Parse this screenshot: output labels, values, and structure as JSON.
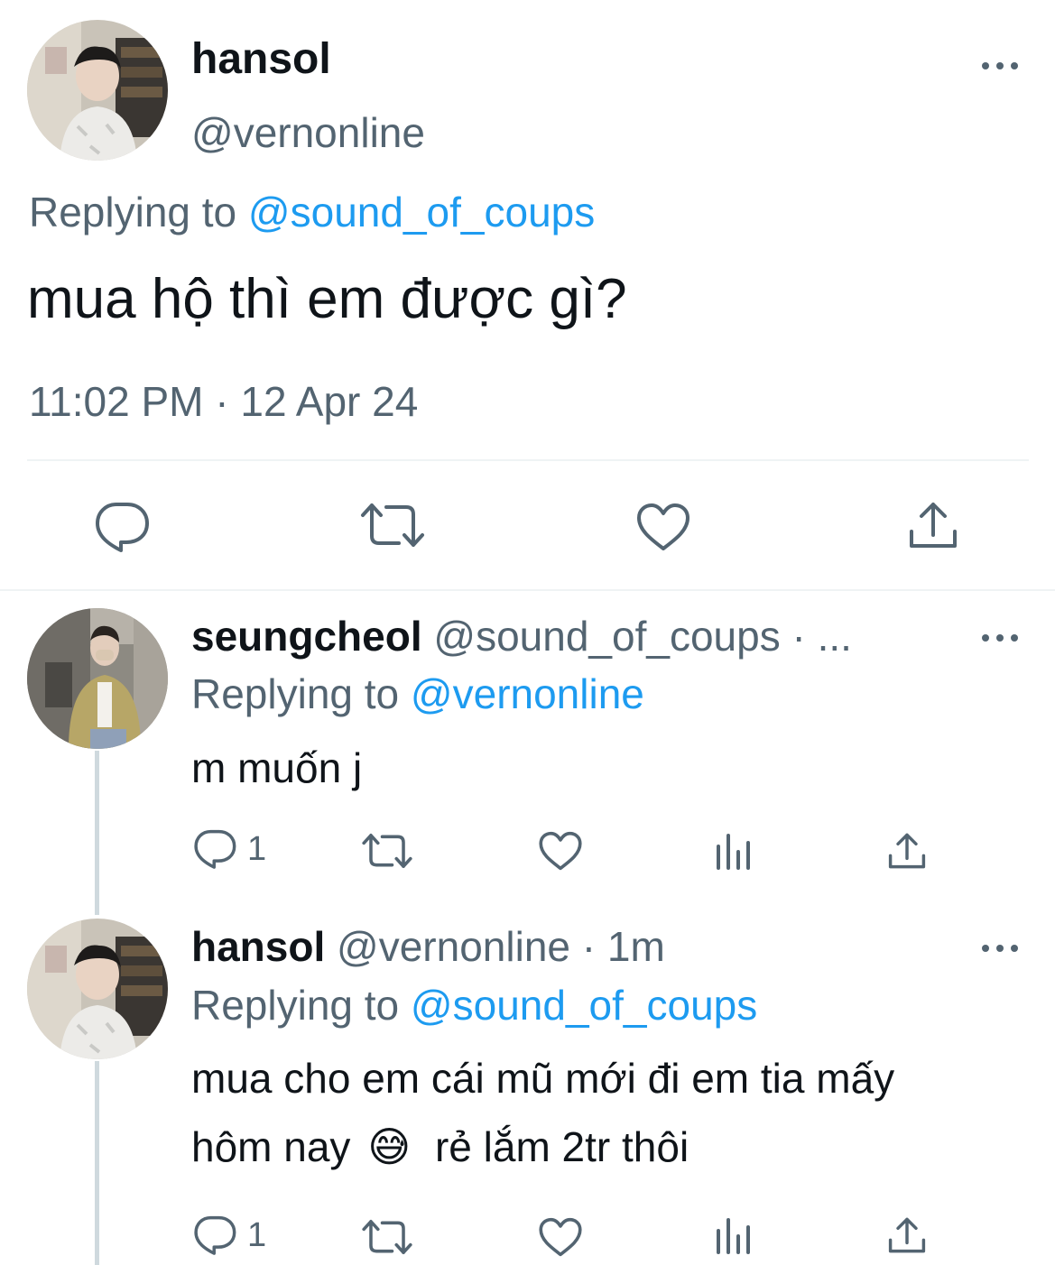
{
  "main_tweet": {
    "display_name": "hansol",
    "handle": "@vernonline",
    "replying_prefix": "Replying to",
    "replying_to": "@sound_of_coups",
    "text": "mua hộ thì em được gì?",
    "timestamp": "11:02 PM · 12 Apr 24"
  },
  "replies": [
    {
      "display_name": "seungcheol",
      "handle_meta": "@sound_of_coups · ...",
      "replying_prefix": "Replying to",
      "replying_to": "@vernonline",
      "text": "m muốn j",
      "reply_count": "1"
    },
    {
      "display_name": "hansol",
      "handle_meta": "@vernonline · 1m",
      "replying_prefix": "Replying to",
      "replying_to": "@sound_of_coups",
      "text_line1": "mua cho em cái mũ mới đi em tia mấy",
      "text_line2_a": "hôm nay",
      "emoji": "😅",
      "text_line2_b": "rẻ lắm 2tr thôi",
      "reply_count": "1"
    }
  ],
  "icons": {
    "reply": "speech-bubble-icon",
    "retweet": "retweet-arrows-icon",
    "like": "heart-icon",
    "share": "share-upload-icon",
    "views": "bar-chart-icon",
    "more": "more-dots-icon"
  },
  "colors": {
    "text": "#0f1419",
    "muted": "#536471",
    "link": "#1d9bf0",
    "divider": "#eff3f4",
    "thread_line": "#cfd9de"
  }
}
